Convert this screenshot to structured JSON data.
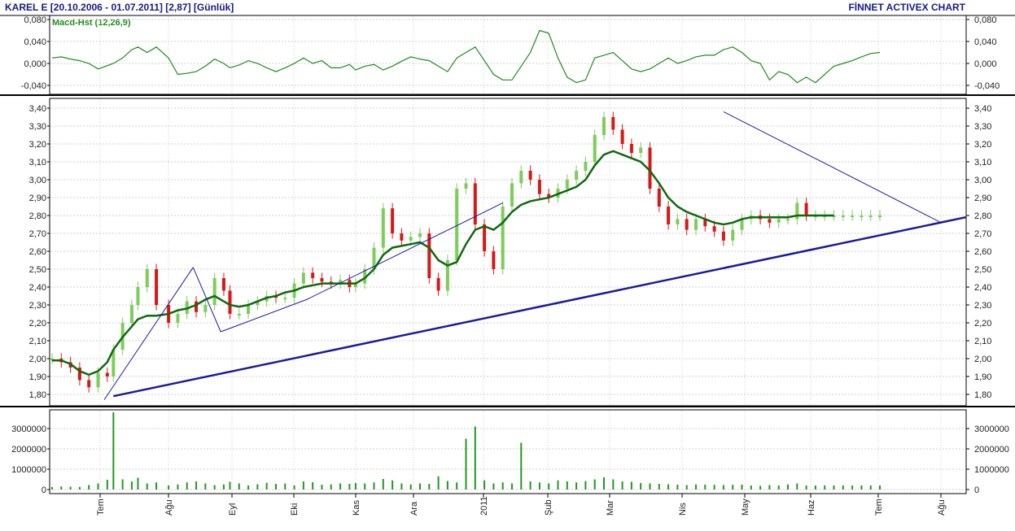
{
  "header": {
    "title": "KAREL E  [20.10.2006 - 01.07.2011]  [2,87]  [Günlük]",
    "brand": "FİNNET ACTIVEX CHART"
  },
  "colors": {
    "title": "#1a1a8c",
    "macd": "#1e8c1e",
    "price_up": "#7ccd5a",
    "price_down": "#d81818",
    "moving_average": "#0f6a0f",
    "trendline": "#1a1aa0",
    "volume": "#1f9a1f",
    "grid": "#cfcfcf"
  },
  "chart_data": [
    {
      "type": "line",
      "panel": "macd",
      "title": "Macd-Hst (12,26,9)",
      "ylim": [
        -0.05,
        0.085
      ],
      "yticks": [
        "0,080",
        "0,040",
        "0,000",
        "-0,040"
      ],
      "ytick_values": [
        0.08,
        0.04,
        0.0,
        -0.04
      ],
      "series": [
        {
          "name": "Macd-Hst (12,26,9)",
          "x": [
            0,
            3,
            6,
            9,
            12,
            15,
            18,
            20,
            23,
            26,
            28,
            31,
            34,
            38,
            41,
            44,
            47,
            50,
            53,
            56,
            58,
            61,
            64,
            67,
            70,
            73,
            76,
            79,
            82,
            85,
            88,
            91,
            94,
            97,
            99,
            102,
            105,
            108,
            111,
            114,
            117,
            120,
            123,
            126,
            129,
            132,
            135,
            138,
            141,
            144,
            147,
            150,
            153,
            156,
            159,
            162,
            165,
            168,
            171,
            174,
            177,
            180,
            183,
            186,
            189,
            192,
            195,
            198,
            201,
            204,
            207,
            210,
            213,
            216,
            219,
            222,
            225,
            228,
            231,
            234,
            237,
            240,
            243,
            246,
            249,
            252,
            255,
            258,
            261,
            264,
            267,
            270
          ],
          "values": [
            0.01,
            0.012,
            0.008,
            0.005,
            0.0,
            -0.01,
            -0.004,
            0.0,
            0.01,
            0.025,
            0.03,
            0.02,
            0.03,
            0.01,
            -0.02,
            -0.018,
            -0.015,
            -0.005,
            0.008,
            0.0,
            -0.008,
            -0.003,
            0.005,
            0.0,
            -0.008,
            -0.015,
            -0.008,
            0.0,
            0.01,
            0.0,
            0.005,
            -0.008,
            -0.008,
            -0.002,
            -0.012,
            -0.005,
            -0.002,
            -0.012,
            -0.005,
            0.004,
            0.012,
            0.008,
            0.005,
            -0.005,
            -0.015,
            0.01,
            0.02,
            0.03,
            0.005,
            -0.02,
            -0.03,
            -0.03,
            -0.005,
            0.02,
            0.06,
            0.055,
            0.01,
            -0.025,
            -0.035,
            -0.03,
            0.01,
            0.015,
            0.02,
            0.005,
            -0.01,
            -0.015,
            -0.01,
            0.0,
            0.01,
            0.0,
            0.005,
            0.012,
            0.015,
            0.015,
            0.025,
            0.03,
            0.02,
            0.005,
            0.0,
            -0.03,
            -0.015,
            -0.02,
            -0.035,
            -0.025,
            -0.035,
            -0.02,
            -0.005,
            0.0,
            0.005,
            0.012,
            0.018,
            0.02
          ]
        }
      ]
    },
    {
      "type": "candlestick",
      "panel": "price",
      "ylim": [
        1.75,
        3.42
      ],
      "yticks": [
        "3,40",
        "3,30",
        "3,20",
        "3,10",
        "3,00",
        "2,90",
        "2,80",
        "2,70",
        "2,60",
        "2,50",
        "2,40",
        "2,30",
        "2,20",
        "2,10",
        "2,00",
        "1,90",
        "1,80"
      ],
      "ytick_values": [
        3.4,
        3.3,
        3.2,
        3.1,
        3.0,
        2.9,
        2.8,
        2.7,
        2.6,
        2.5,
        2.4,
        2.3,
        2.2,
        2.1,
        2.0,
        1.9,
        1.8
      ],
      "series": [
        {
          "name": "close",
          "x": [
            0,
            3,
            6,
            9,
            12,
            15,
            18,
            20,
            23,
            26,
            28,
            31,
            34,
            38,
            41,
            44,
            47,
            50,
            53,
            56,
            58,
            61,
            64,
            67,
            70,
            73,
            76,
            79,
            82,
            85,
            88,
            91,
            94,
            97,
            99,
            102,
            105,
            108,
            111,
            114,
            117,
            120,
            123,
            126,
            129,
            132,
            135,
            138,
            141,
            144,
            147,
            150,
            153,
            156,
            159,
            162,
            165,
            168,
            171,
            174,
            177,
            180,
            183,
            186,
            189,
            192,
            195,
            198,
            201,
            204,
            207,
            210,
            213,
            216,
            219,
            222,
            225,
            228,
            231,
            234,
            237,
            240,
            243,
            246,
            249,
            252,
            255,
            258,
            261,
            264,
            267,
            270
          ],
          "values": [
            2.0,
            1.98,
            1.95,
            1.88,
            1.84,
            1.92,
            1.9,
            2.05,
            2.2,
            2.3,
            2.4,
            2.5,
            2.3,
            2.2,
            2.25,
            2.32,
            2.26,
            2.3,
            2.45,
            2.38,
            2.25,
            2.25,
            2.3,
            2.32,
            2.35,
            2.34,
            2.34,
            2.42,
            2.48,
            2.45,
            2.43,
            2.42,
            2.44,
            2.4,
            2.42,
            2.5,
            2.62,
            2.84,
            2.7,
            2.66,
            2.68,
            2.7,
            2.45,
            2.38,
            2.55,
            2.95,
            2.98,
            2.75,
            2.6,
            2.5,
            2.85,
            2.98,
            3.05,
            3.0,
            2.92,
            2.9,
            2.95,
            3.0,
            3.05,
            3.1,
            3.25,
            3.35,
            3.28,
            3.2,
            3.15,
            3.18,
            2.95,
            2.85,
            2.75,
            2.78,
            2.72,
            2.78,
            2.74,
            2.71,
            2.66,
            2.72,
            2.78,
            2.8,
            2.78,
            2.76,
            2.78,
            2.78,
            2.87,
            2.8,
            2.8,
            2.8,
            2.8,
            2.8,
            2.8,
            2.8,
            2.8,
            2.8
          ]
        },
        {
          "name": "moving_average",
          "x": [
            0,
            3,
            6,
            9,
            12,
            15,
            18,
            20,
            23,
            26,
            28,
            31,
            34,
            38,
            41,
            44,
            47,
            50,
            53,
            56,
            58,
            61,
            64,
            67,
            70,
            73,
            76,
            79,
            82,
            85,
            88,
            91,
            94,
            97,
            99,
            102,
            105,
            108,
            111,
            114,
            117,
            120,
            123,
            126,
            129,
            132,
            135,
            138,
            141,
            144,
            147,
            150,
            153,
            156,
            159,
            162,
            165,
            168,
            171,
            174,
            177,
            180,
            183,
            186,
            189,
            192,
            195,
            198,
            201,
            204,
            207,
            210,
            213,
            216,
            219,
            222,
            225,
            228,
            231,
            234,
            237,
            240,
            243,
            246,
            249,
            252,
            255
          ],
          "values": [
            1.99,
            1.99,
            1.97,
            1.93,
            1.91,
            1.93,
            1.98,
            2.05,
            2.12,
            2.18,
            2.22,
            2.24,
            2.24,
            2.25,
            2.27,
            2.28,
            2.3,
            2.33,
            2.35,
            2.32,
            2.3,
            2.29,
            2.3,
            2.32,
            2.34,
            2.35,
            2.37,
            2.38,
            2.4,
            2.41,
            2.42,
            2.42,
            2.42,
            2.42,
            2.42,
            2.45,
            2.5,
            2.58,
            2.62,
            2.63,
            2.64,
            2.65,
            2.62,
            2.55,
            2.52,
            2.54,
            2.64,
            2.72,
            2.74,
            2.72,
            2.76,
            2.82,
            2.86,
            2.88,
            2.89,
            2.9,
            2.92,
            2.94,
            2.96,
            3.0,
            3.08,
            3.14,
            3.16,
            3.14,
            3.12,
            3.1,
            3.05,
            2.98,
            2.9,
            2.85,
            2.82,
            2.8,
            2.78,
            2.76,
            2.75,
            2.76,
            2.78,
            2.79,
            2.79,
            2.79,
            2.79,
            2.79,
            2.8,
            2.8,
            2.8,
            2.8,
            2.8
          ]
        }
      ],
      "trendlines": [
        {
          "x1": 20,
          "y1": 1.79,
          "x2": 298,
          "y2": 2.79
        },
        {
          "x1": 17,
          "y1": 1.77,
          "x2": 46,
          "y2": 2.51
        },
        {
          "x1": 46,
          "y1": 2.51,
          "x2": 55,
          "y2": 2.15
        },
        {
          "x1": 55,
          "y1": 2.15,
          "x2": 83,
          "y2": 2.33
        },
        {
          "x1": 83,
          "y1": 2.33,
          "x2": 147,
          "y2": 2.87
        },
        {
          "x1": 219,
          "y1": 3.38,
          "x2": 290,
          "y2": 2.76
        }
      ]
    },
    {
      "type": "bar",
      "panel": "volume",
      "ylim": [
        0,
        4000000
      ],
      "yticks": [
        "3000000",
        "2000000",
        "1000000",
        "0"
      ],
      "ytick_values": [
        3000000,
        2000000,
        1000000,
        0
      ],
      "series": [
        {
          "name": "volume",
          "x": [
            0,
            3,
            6,
            9,
            12,
            15,
            18,
            20,
            23,
            26,
            28,
            31,
            34,
            38,
            41,
            44,
            47,
            50,
            53,
            56,
            58,
            61,
            64,
            67,
            70,
            73,
            76,
            79,
            82,
            85,
            88,
            91,
            94,
            97,
            99,
            102,
            105,
            108,
            111,
            114,
            117,
            120,
            123,
            126,
            129,
            132,
            135,
            138,
            141,
            144,
            147,
            150,
            153,
            156,
            159,
            162,
            165,
            168,
            171,
            174,
            177,
            180,
            183,
            186,
            189,
            192,
            195,
            198,
            201,
            204,
            207,
            210,
            213,
            216,
            219,
            222,
            225,
            228,
            231,
            234,
            237,
            240,
            243,
            246,
            249,
            252,
            255,
            258,
            261,
            264,
            267,
            270
          ],
          "values": [
            120000,
            150000,
            140000,
            130000,
            220000,
            300000,
            480000,
            3800000,
            500000,
            400000,
            580000,
            300000,
            350000,
            200000,
            250000,
            350000,
            400000,
            300000,
            220000,
            250000,
            380000,
            300000,
            200000,
            260000,
            330000,
            280000,
            300000,
            200000,
            400000,
            360000,
            240000,
            250000,
            300000,
            280000,
            320000,
            300000,
            350000,
            520000,
            450000,
            300000,
            250000,
            300000,
            280000,
            650000,
            420000,
            350000,
            2500000,
            3100000,
            450000,
            300000,
            350000,
            300000,
            2300000,
            400000,
            350000,
            300000,
            450000,
            400000,
            350000,
            420000,
            500000,
            600000,
            500000,
            400000,
            380000,
            320000,
            300000,
            280000,
            260000,
            240000,
            220000,
            250000,
            240000,
            230000,
            220000,
            230000,
            240000,
            200000,
            180000,
            220000,
            200000,
            250000,
            300000,
            200000,
            200000,
            200000,
            200000,
            200000,
            200000,
            200000,
            200000,
            200000
          ]
        }
      ]
    }
  ],
  "xaxis": {
    "labels": [
      "Tem",
      "Ağu",
      "Eyl",
      "Eki",
      "Kas",
      "Ara",
      "2011",
      "Şub",
      "Mar",
      "Nis",
      "May",
      "Haz",
      "Tem",
      "Ağu"
    ]
  }
}
